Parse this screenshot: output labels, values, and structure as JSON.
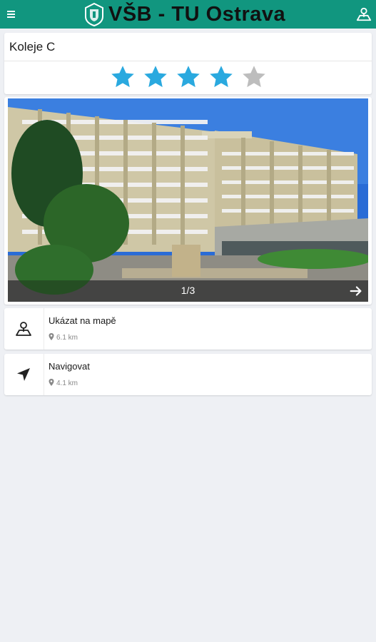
{
  "app": {
    "title": "VŠB - TU Ostrava",
    "theme_color": "#11967f",
    "icons": {
      "menu": "menu-icon",
      "logo": "vsb-logo",
      "map": "map-icon"
    }
  },
  "place": {
    "name": "Koleje C",
    "rating": {
      "value": 4,
      "max": 5,
      "filled_color": "#2aa9df",
      "empty_color": "#bdbdbd"
    }
  },
  "gallery": {
    "counter": "1/3",
    "current": 1,
    "total": 3,
    "next_icon": "arrow-right-icon"
  },
  "actions": [
    {
      "label": "Ukázat na mapě",
      "distance": "6.1 km",
      "icon": "map-marker-icon"
    },
    {
      "label": "Navigovat",
      "distance": "4.1 km",
      "icon": "navigation-arrow-icon"
    }
  ]
}
